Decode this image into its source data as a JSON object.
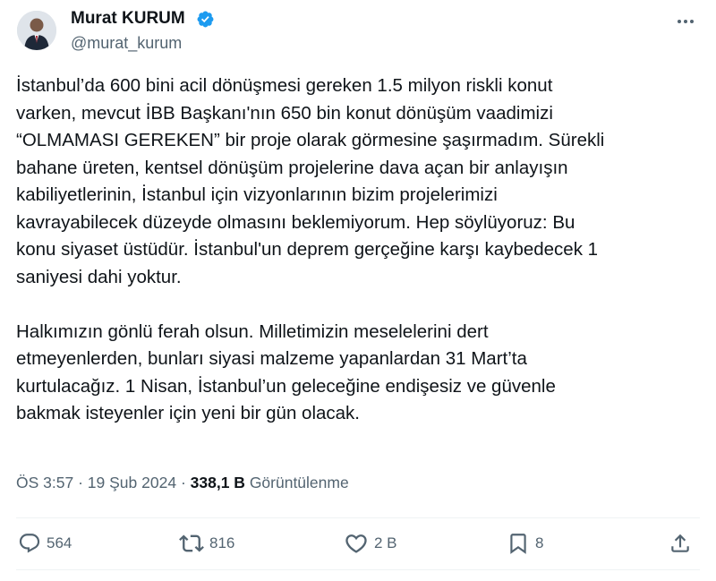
{
  "author": {
    "name": "Murat KURUM",
    "handle": "@murat_kurum",
    "verified": true
  },
  "tweet": {
    "paragraphs": [
      [
        "İstanbul’da 600 bini acil dönüşmesi gereken 1.5 milyon riskli konut",
        "varken, mevcut İBB Başkanı'nın 650 bin konut dönüşüm vaadimizi",
        "“OLMAMASI GEREKEN” bir proje olarak görmesine şaşırmadım. Sürekli",
        "bahane üreten, kentsel dönüşüm projelerine dava açan bir anlayışın",
        "kabiliyetlerinin, İstanbul için vizyonlarının bizim projelerimizi",
        "kavrayabilecek düzeyde olmasını beklemiyorum. Hep söylüyoruz: Bu",
        "konu siyaset üstüdür. İstanbul'un deprem gerçeğine karşı kaybedecek 1",
        "saniyesi dahi yoktur."
      ],
      [
        "Halkımızın gönlü ferah olsun. Milletimizin meselelerini dert",
        "etmeyenlerden, bunları siyasi malzeme yapanlardan 31 Mart’ta",
        "kurtulacağız. 1 Nisan, İstanbul’un geleceğine endişesiz ve güvenle",
        "bakmak isteyenler için yeni bir gün olacak."
      ]
    ]
  },
  "meta": {
    "time": "ÖS 3:57",
    "separator": "·",
    "date": "19 Şub 2024",
    "views_count": "338,1 B",
    "views_label": "Görüntülenme"
  },
  "actions": {
    "replies": "564",
    "reposts": "816",
    "likes": "2 B",
    "bookmarks": "8"
  },
  "colors": {
    "text": "#0f1419",
    "secondary": "#536471",
    "verified": "#1d9bf0",
    "divider": "#eff3f4"
  },
  "icons": {
    "more": "more-options-icon",
    "reply": "reply-icon",
    "repost": "repost-icon",
    "like": "heart-icon",
    "bookmark": "bookmark-icon",
    "share": "share-icon"
  }
}
